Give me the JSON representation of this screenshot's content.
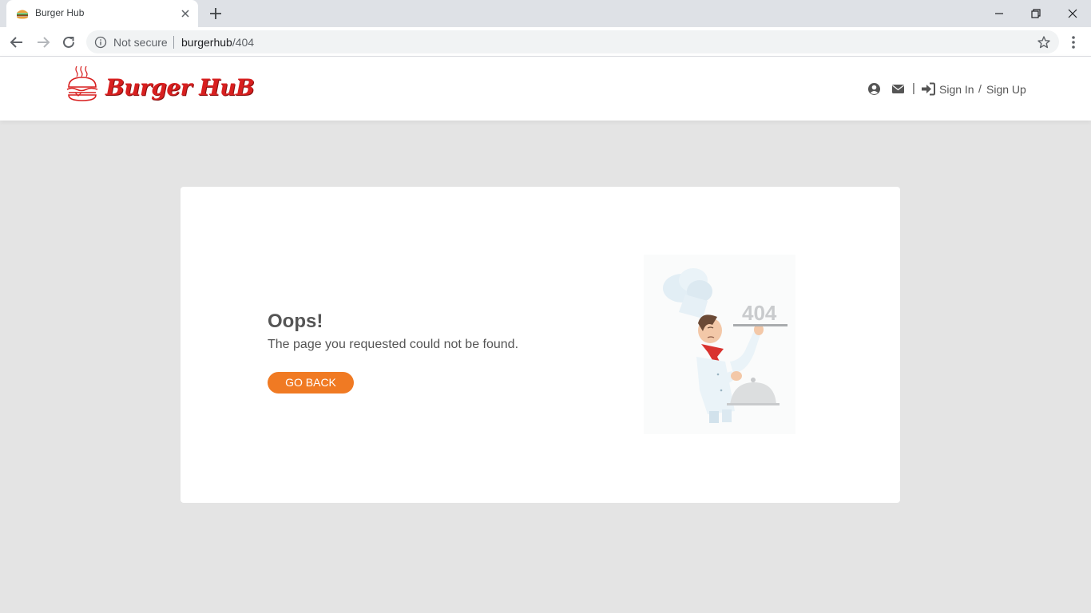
{
  "browser": {
    "tab_title": "Burger Hub",
    "security_label": "Not secure",
    "url_host": "burgerhub",
    "url_path": "/404"
  },
  "header": {
    "logo_text": "Burger HuB",
    "signin_label": "Sign In",
    "separator": "/",
    "signup_label": "Sign Up",
    "pipe": "|",
    "icons": [
      "user-circle-icon",
      "envelope-icon",
      "sign-in-icon"
    ]
  },
  "error": {
    "heading": "Oops!",
    "message": "The page you requested could not be found.",
    "button_label": "GO BACK",
    "illustration_text": "404"
  },
  "colors": {
    "accent": "#f07a23",
    "brand": "#d81f1f",
    "page_bg": "#e4e4e4"
  }
}
